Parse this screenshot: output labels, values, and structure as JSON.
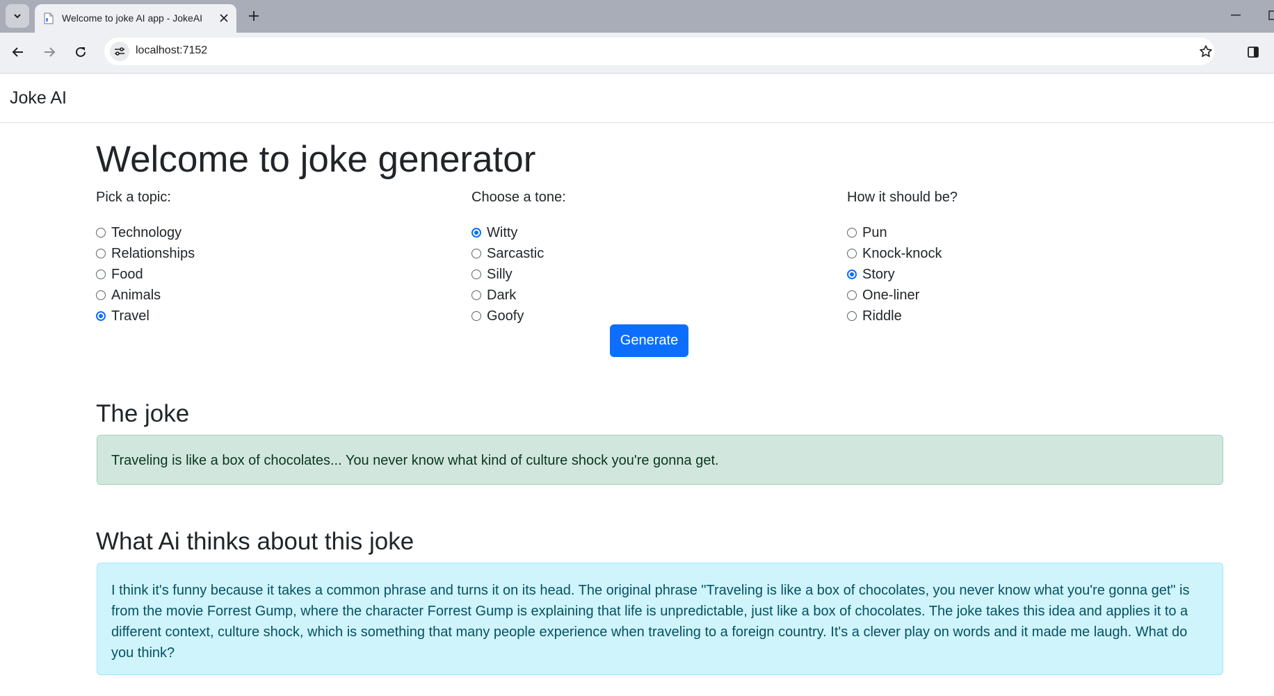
{
  "browser": {
    "tab_title": "Welcome to joke AI app - JokeAI",
    "url": "localhost:7152"
  },
  "navbar": {
    "brand": "Joke AI"
  },
  "page": {
    "title": "Welcome to joke generator"
  },
  "form": {
    "topic": {
      "label": "Pick a topic:",
      "options": [
        "Technology",
        "Relationships",
        "Food",
        "Animals",
        "Travel"
      ],
      "selected": "Travel"
    },
    "tone": {
      "label": "Choose a tone:",
      "options": [
        "Witty",
        "Sarcastic",
        "Silly",
        "Dark",
        "Goofy"
      ],
      "selected": "Witty"
    },
    "style": {
      "label": "How it should be?",
      "options": [
        "Pun",
        "Knock-knock",
        "Story",
        "One-liner",
        "Riddle"
      ],
      "selected": "Story"
    },
    "generate_label": "Generate"
  },
  "joke": {
    "heading": "The joke",
    "text": "Traveling is like a box of chocolates... You never know what kind of culture shock you're gonna get."
  },
  "ai_opinion": {
    "heading": "What Ai thinks about this joke",
    "text": "I think it's funny because it takes a common phrase and turns it on its head. The original phrase \"Traveling is like a box of chocolates, you never know what you're gonna get\" is from the movie Forrest Gump, where the character Forrest Gump is explaining that life is unpredictable, just like a box of chocolates. The joke takes this idea and applies it to a different context, culture shock, which is something that many people experience when traveling to a foreign country. It's a clever play on words and it made me laugh. What do you think?"
  },
  "colors": {
    "primary": "#0d6efd",
    "success_bg": "#d1e7dd",
    "success_text": "#0a3622",
    "info_bg": "#cff4fc",
    "info_text": "#055160"
  },
  "icons": [
    "tab-search-icon",
    "page-favicon-icon",
    "close-icon",
    "plus-icon",
    "minimize-icon",
    "back-arrow-icon",
    "forward-arrow-icon",
    "reload-icon",
    "site-info-icon",
    "bookmark-star-icon",
    "side-panel-icon"
  ]
}
